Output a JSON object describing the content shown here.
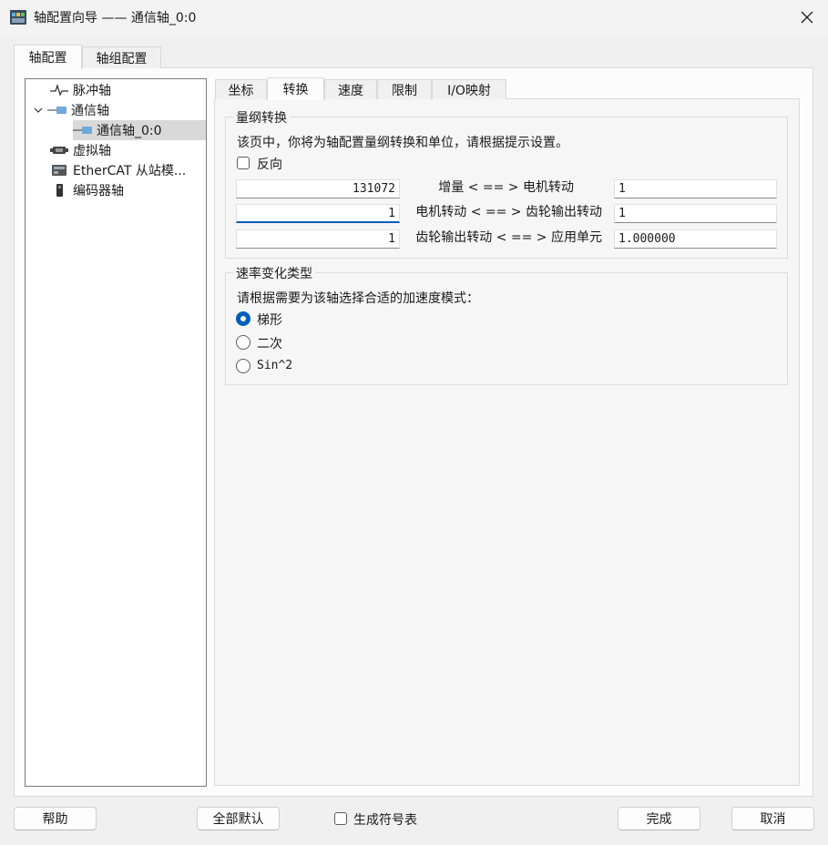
{
  "window": {
    "title": "轴配置向导 —— 通信轴_0:0"
  },
  "outer_tabs": [
    {
      "label": "轴配置",
      "active": true
    },
    {
      "label": "轴组配置",
      "active": false
    }
  ],
  "tree": {
    "items": [
      {
        "label": "脉冲轴",
        "icon": "pulse-icon",
        "level": 0
      },
      {
        "label": "通信轴",
        "icon": "comm-axis-icon",
        "level": 0,
        "expanded": true
      },
      {
        "label": "通信轴_0:0",
        "icon": "comm-axis-icon",
        "level": 1,
        "selected": true
      },
      {
        "label": "虚拟轴",
        "icon": "virtual-axis-icon",
        "level": 0
      },
      {
        "label": "EtherCAT 从站模...",
        "icon": "ethercat-slave-icon",
        "level": 0
      },
      {
        "label": "编码器轴",
        "icon": "encoder-icon",
        "level": 0
      }
    ]
  },
  "inner_tabs": [
    {
      "label": "坐标",
      "active": false
    },
    {
      "label": "转换",
      "active": true
    },
    {
      "label": "速度",
      "active": false
    },
    {
      "label": "限制",
      "active": false
    },
    {
      "label": "I/O映射",
      "active": false
    }
  ],
  "conversion": {
    "group_title": "量纲转换",
    "description": "该页中，你将为轴配置量纲转换和单位，请根据提示设置。",
    "reverse_label": "反向",
    "reverse_checked": false,
    "rows": [
      {
        "left_value": "131072",
        "label": "增量 < == > 电机转动",
        "right_value": "1"
      },
      {
        "left_value": "1",
        "label": "电机转动 < == > 齿轮输出转动",
        "right_value": "1"
      },
      {
        "left_value": "1",
        "label": "齿轮输出转动 < == > 应用单元",
        "right_value": "1.000000"
      }
    ]
  },
  "ramp": {
    "group_title": "速率变化类型",
    "description": "请根据需要为该轴选择合适的加速度模式：",
    "options": [
      {
        "label": "梯形",
        "checked": true
      },
      {
        "label": "二次",
        "checked": false
      },
      {
        "label": "Sin^2",
        "checked": false
      }
    ]
  },
  "footer": {
    "help_label": "帮助",
    "defaults_label": "全部默认",
    "symbol_table_label": "生成符号表",
    "symbol_table_checked": false,
    "finish_label": "完成",
    "cancel_label": "取消"
  },
  "colors": {
    "accent": "#005fb8",
    "selection": "#d9d9d9"
  }
}
